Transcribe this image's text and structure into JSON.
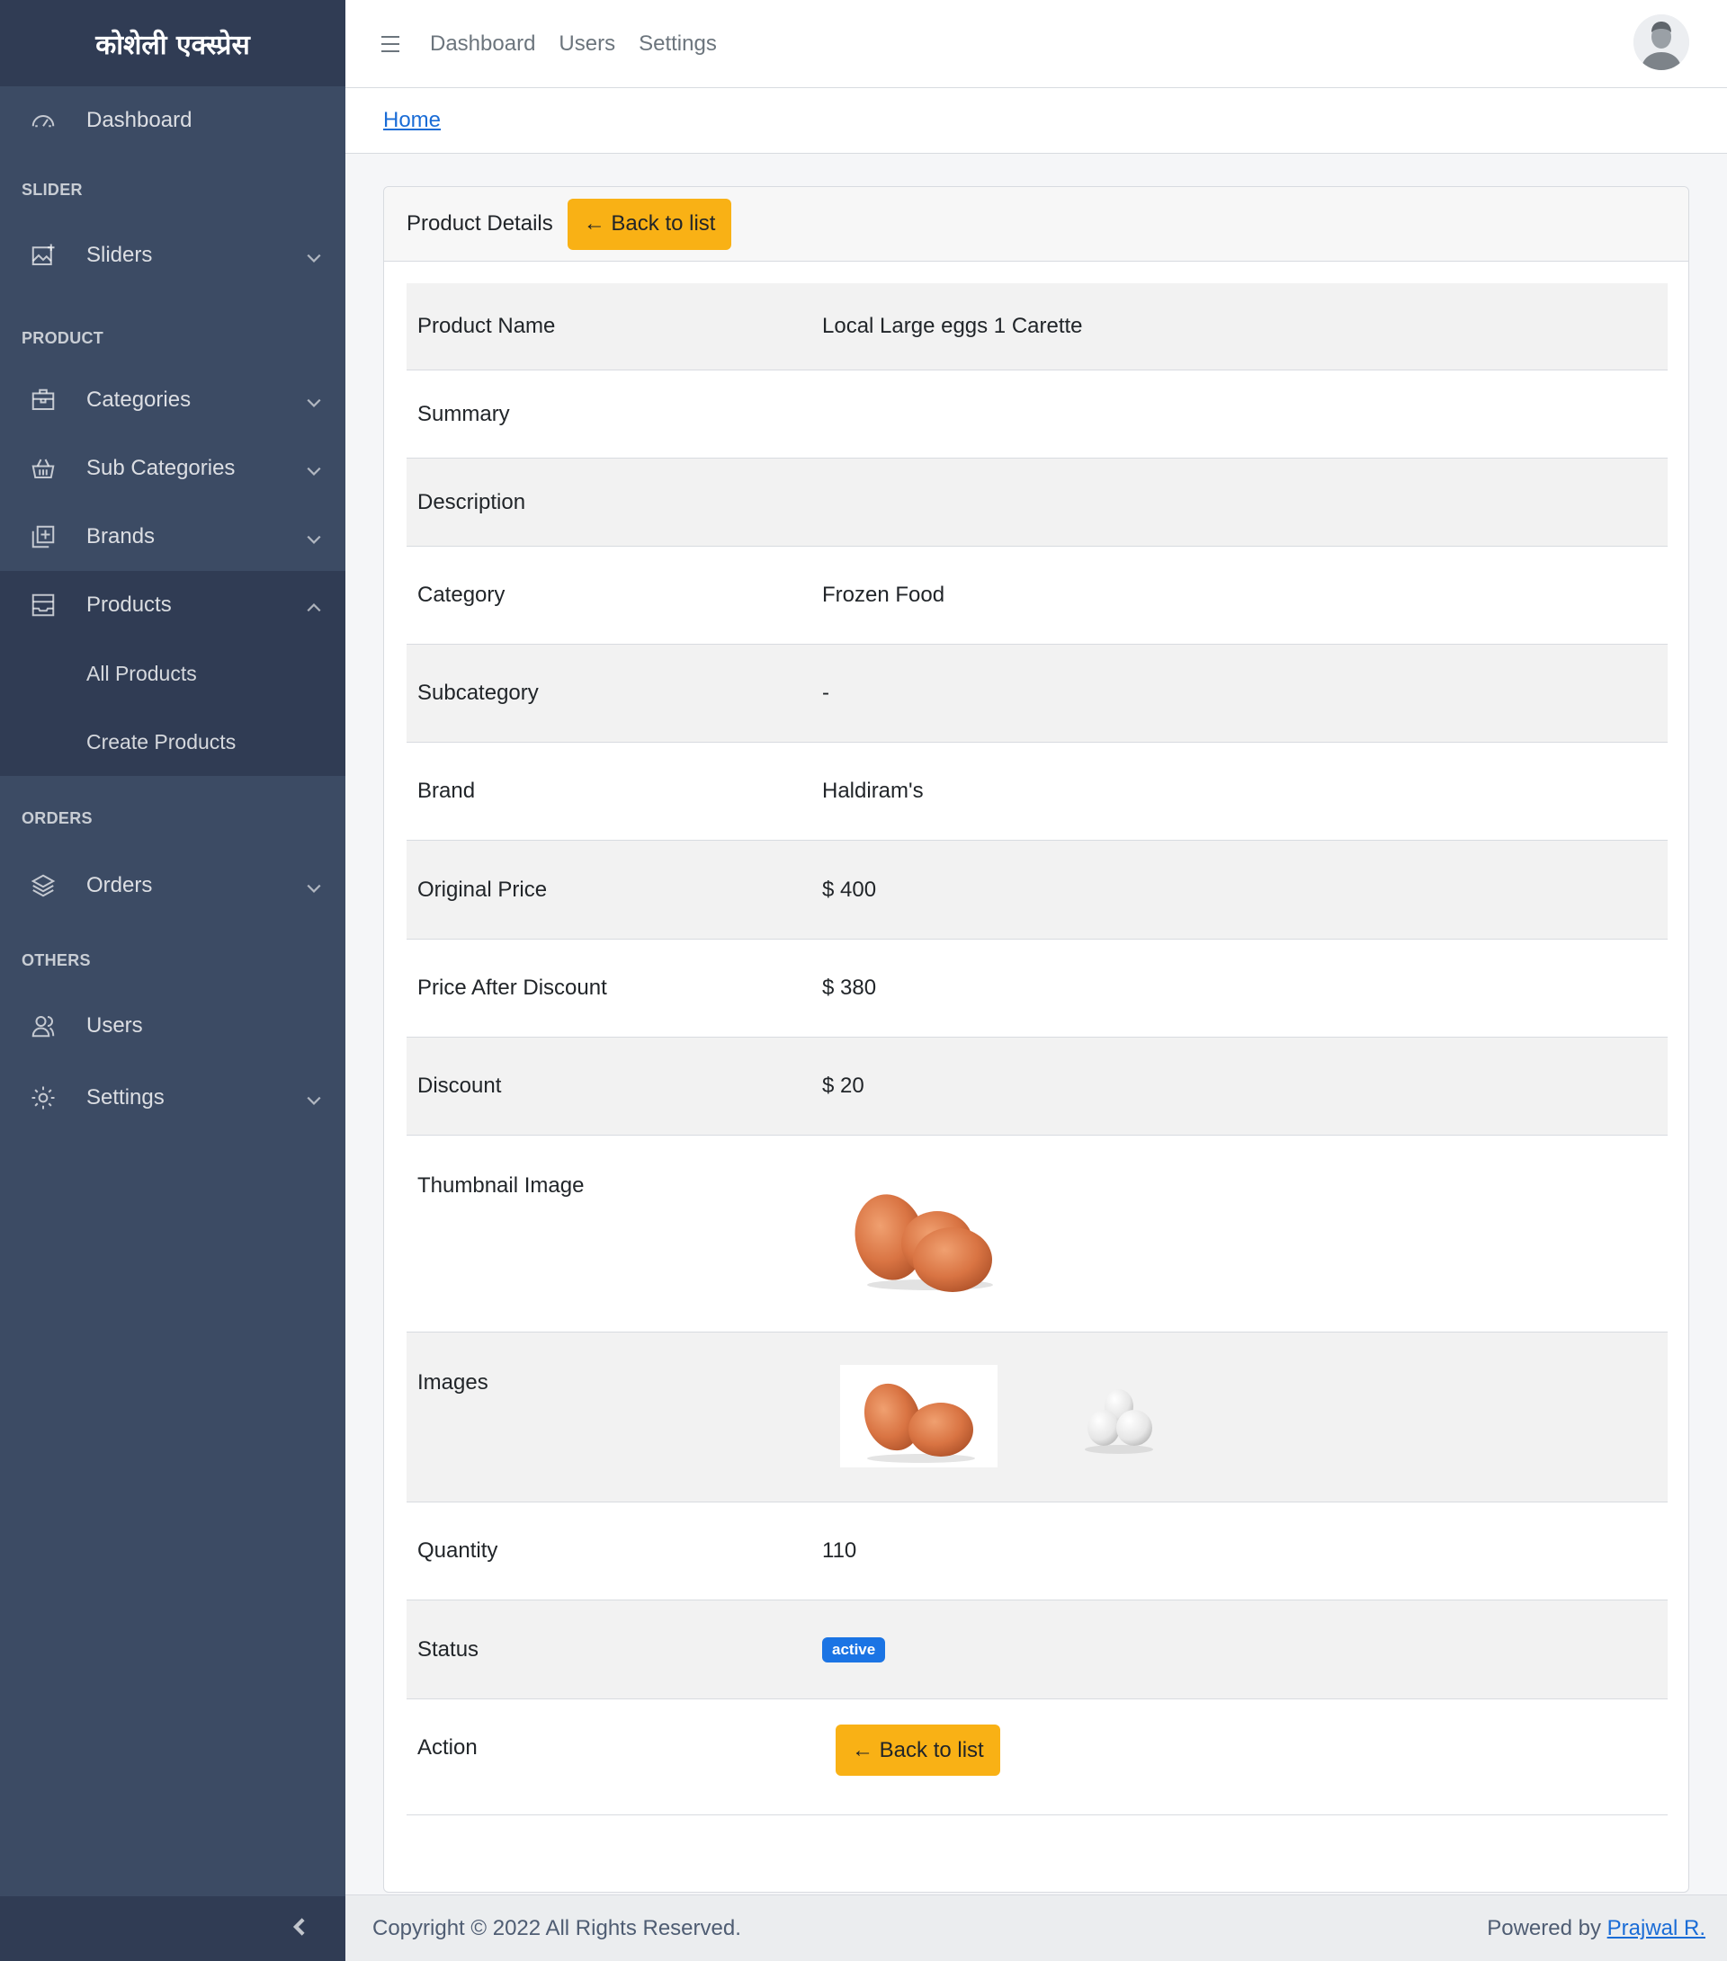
{
  "brand": {
    "title": "कोशेली एक्स्प्रेस"
  },
  "sidebar": {
    "dashboard": "Dashboard",
    "section_slider": "SLIDER",
    "sliders": "Sliders",
    "section_product": "PRODUCT",
    "categories": "Categories",
    "sub_categories": "Sub Categories",
    "brands": "Brands",
    "products": "Products",
    "all_products": "All Products",
    "create_products": "Create Products",
    "section_orders": "ORDERS",
    "orders": "Orders",
    "section_others": "OTHERS",
    "users": "Users",
    "settings": "Settings"
  },
  "header": {
    "nav": [
      "Dashboard",
      "Users",
      "Settings"
    ]
  },
  "breadcrumb": {
    "home": "Home"
  },
  "card": {
    "title": "Product Details",
    "back_button": "← Back to list"
  },
  "details": {
    "product_name_label": "Product Name",
    "product_name": "Local Large eggs 1 Carette",
    "summary_label": "Summary",
    "summary": "",
    "description_label": "Description",
    "description": "",
    "category_label": "Category",
    "category": "Frozen Food",
    "subcategory_label": "Subcategory",
    "subcategory": "-",
    "brand_label": "Brand",
    "brand": "Haldiram's",
    "original_price_label": "Original Price",
    "original_price": "$ 400",
    "price_after_discount_label": "Price After Discount",
    "price_after_discount": "$ 380",
    "discount_label": "Discount",
    "discount": "$ 20",
    "thumbnail_label": "Thumbnail Image",
    "images_label": "Images",
    "quantity_label": "Quantity",
    "quantity": "110",
    "status_label": "Status",
    "status": "active",
    "action_label": "Action",
    "action_button": "← Back to list"
  },
  "footer": {
    "copyright": "Copyright © 2022 All Rights Reserved.",
    "powered_by": "Powered by",
    "author": "Prajwal R."
  },
  "colors": {
    "sidebar": "#3c4b64",
    "sidebar_dark": "#303c54",
    "warning": "#f9b115",
    "badge": "#1b74e4",
    "link": "#1a6cd6"
  }
}
